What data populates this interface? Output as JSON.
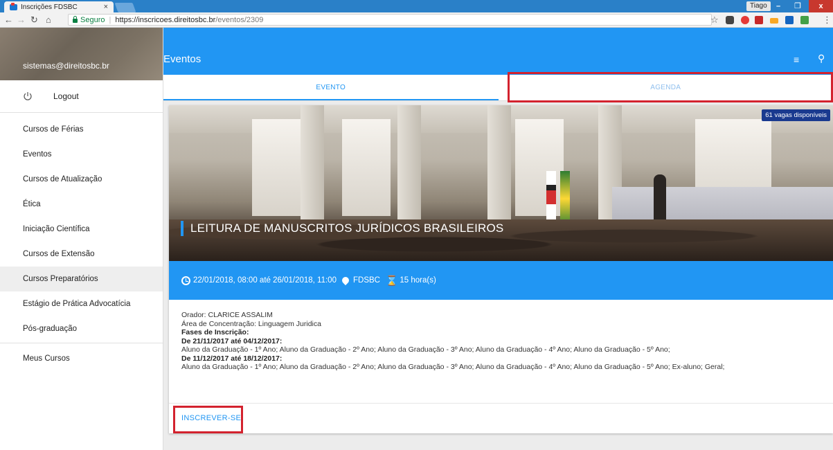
{
  "browser": {
    "tab_title": "Inscrições FDSBC",
    "tab_close": "×",
    "user": "Tiago",
    "secure_label": "Seguro",
    "url_host": "https://inscricoes.direitosbc.br",
    "url_path": "/eventos/2309",
    "window_min": "–",
    "window_max": "❐",
    "window_close": "x"
  },
  "sidebar": {
    "email": "sistemas@direitosbc.br",
    "logout_label": "Logout",
    "items": [
      {
        "label": "Cursos de Férias"
      },
      {
        "label": "Eventos"
      },
      {
        "label": "Cursos de Atualização"
      },
      {
        "label": "Ética"
      },
      {
        "label": "Iniciação Científica"
      },
      {
        "label": "Cursos de Extensão"
      },
      {
        "label": "Cursos Preparatórios"
      },
      {
        "label": "Estágio de Prática Advocatícia"
      },
      {
        "label": "Pós-graduação"
      }
    ],
    "secondary": "Meus Cursos"
  },
  "appbar": {
    "title": "Eventos",
    "filter_icon": "≡",
    "search_icon": "⚲"
  },
  "tabs": {
    "evento": "EVENTO",
    "agenda": "AGENDA"
  },
  "event": {
    "vagas": "61 vagas disponíveis",
    "title": "LEITURA DE MANUSCRITOS JURÍDICOS BRASILEIROS",
    "datetime": "22/01/2018, 08:00 até 26/01/2018, 11:00",
    "location": "FDSBC",
    "hourglass": "⌛",
    "hours": "15 hora(s)",
    "orador": "Orador: CLARICE ASSALIM",
    "area": "Área de Concentração: Linguagem Juridica",
    "fases_label": "Fases de Inscrição:",
    "fase1_title": "De 21/11/2017 até 04/12/2017:",
    "fase1_text": "Aluno da Graduação - 1º Ano; Aluno da Graduação - 2º Ano; Aluno da Graduação - 3º Ano; Aluno da Graduação - 4º Ano; Aluno da Graduação - 5º Ano;",
    "fase2_title": "De 11/12/2017 até 18/12/2017:",
    "fase2_text": "Aluno da Graduação - 1º Ano; Aluno da Graduação - 2º Ano; Aluno da Graduação - 3º Ano; Aluno da Graduação - 4º Ano; Aluno da Graduação - 5º Ano; Ex-aluno; Geral;",
    "action": "INSCREVER-SE"
  },
  "colors": {
    "primary": "#2196f3",
    "highlight": "#d3222e",
    "badge": "#1a3a8f"
  }
}
